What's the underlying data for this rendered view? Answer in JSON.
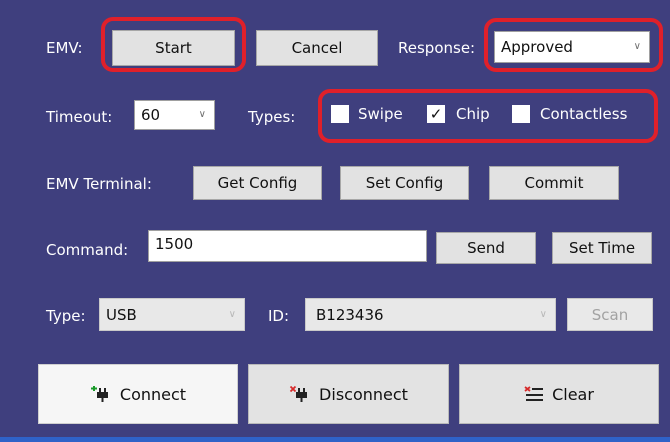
{
  "row1": {
    "emv_label": "EMV:",
    "start_label": "Start",
    "cancel_label": "Cancel",
    "response_label": "Response:",
    "response_value": "Approved"
  },
  "row2": {
    "timeout_label": "Timeout:",
    "timeout_value": "60",
    "types_label": "Types:",
    "types": [
      {
        "label": "Swipe",
        "checked": false
      },
      {
        "label": "Chip",
        "checked": true
      },
      {
        "label": "Contactless",
        "checked": false
      }
    ]
  },
  "row3": {
    "terminal_label": "EMV Terminal:",
    "get_config_label": "Get Config",
    "set_config_label": "Set Config",
    "commit_label": "Commit"
  },
  "row4": {
    "command_label": "Command:",
    "command_value": "1500",
    "send_label": "Send",
    "set_time_label": "Set Time"
  },
  "row5": {
    "type_label": "Type:",
    "type_value": "USB",
    "id_label": "ID:",
    "id_value": "B123436",
    "scan_label": "Scan"
  },
  "row6": {
    "connect_label": "Connect",
    "disconnect_label": "Disconnect",
    "clear_label": "Clear"
  },
  "colors": {
    "background": "#3f3f7e",
    "highlight": "#e0202a",
    "bottom_line": "#2f62c8"
  },
  "icons": {
    "connect": "plug-connect-icon",
    "disconnect": "plug-disconnect-icon",
    "clear": "clear-list-icon",
    "dropdown": "chevron-down-icon"
  }
}
